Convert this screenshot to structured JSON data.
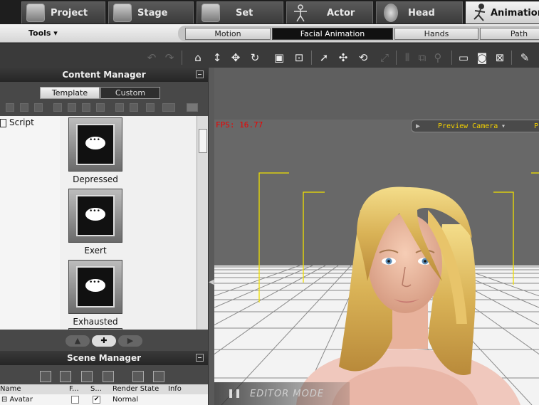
{
  "top_tabs": [
    {
      "label": "Project",
      "icon": "project-icon",
      "active": false
    },
    {
      "label": "Stage",
      "icon": "stage-icon",
      "active": false
    },
    {
      "label": "Set",
      "icon": "set-icon",
      "active": false
    },
    {
      "label": "Actor",
      "icon": "actor-icon",
      "active": false
    },
    {
      "label": "Head",
      "icon": "head-icon",
      "active": false
    },
    {
      "label": "Animation",
      "icon": "animation-icon",
      "active": true
    }
  ],
  "tools_menu": "Tools ▾",
  "sub_tabs": [
    {
      "label": "Motion",
      "active": false
    },
    {
      "label": "Facial Animation",
      "active": true
    },
    {
      "label": "Hands",
      "active": false
    },
    {
      "label": "Path",
      "active": false
    }
  ],
  "content_manager": {
    "title": "Content Manager",
    "tabs": {
      "template": "Template",
      "custom": "Custom"
    },
    "tree_node": "Script",
    "items": [
      {
        "label": "Depressed",
        "icon": "speech-script-icon"
      },
      {
        "label": "Exert",
        "icon": "speech-script-icon"
      },
      {
        "label": "Exhausted",
        "icon": "speech-script-icon"
      }
    ]
  },
  "scene_manager": {
    "title": "Scene Manager",
    "columns": {
      "name": "Name",
      "f": "F...",
      "s": "S...",
      "render_state": "Render State",
      "info": "Info"
    },
    "rows": [
      {
        "name": "⊟ Avatar",
        "f": false,
        "s": true,
        "render_state": "Normal",
        "info": ""
      }
    ]
  },
  "viewport": {
    "fps": "FPS: 16.77",
    "camera": "Preview Camera",
    "camera_next": "P",
    "mode": "EDITOR MODE"
  }
}
